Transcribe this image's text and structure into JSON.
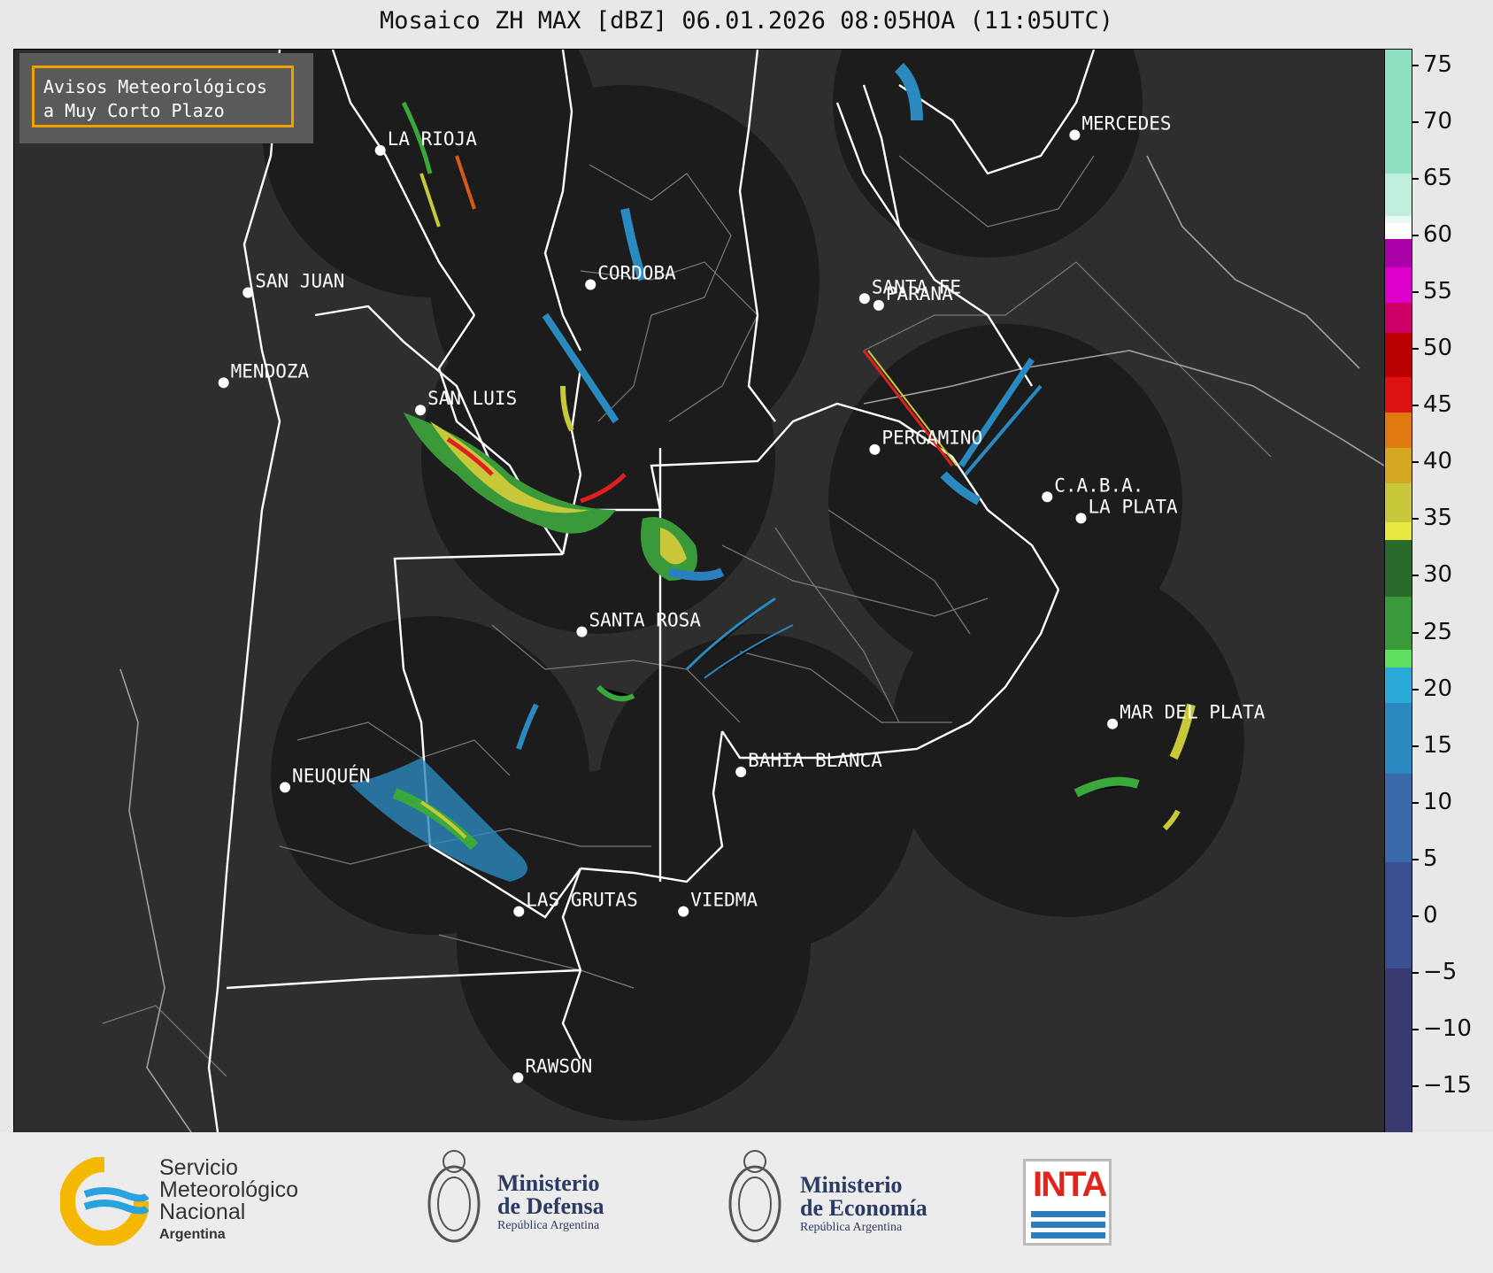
{
  "title": "Mosaico ZH MAX [dBZ] 06.01.2026 08:05HOA (11:05UTC)",
  "notice": {
    "line1": "Avisos Meteorológicos",
    "line2": "a Muy Corto Plazo"
  },
  "colors": {
    "notice_border": "#f0a000",
    "radar_coverage": "#1c1c1c",
    "map_background": "#2e2e2e",
    "province_border": "#ffffff"
  },
  "cities": [
    {
      "name": "LA RIOJA",
      "lon": -66.85,
      "lat": -29.41
    },
    {
      "name": "SAN JUAN",
      "lon": -68.53,
      "lat": -31.54
    },
    {
      "name": "CORDOBA",
      "lon": -64.18,
      "lat": -31.42
    },
    {
      "name": "SANTA FE",
      "lon": -60.7,
      "lat": -31.63
    },
    {
      "name": "PARANA",
      "lon": -60.52,
      "lat": -31.73
    },
    {
      "name": "MERCEDES",
      "lon": -58.03,
      "lat": -29.18
    },
    {
      "name": "MENDOZA",
      "lon": -68.84,
      "lat": -32.89
    },
    {
      "name": "SAN LUIS",
      "lon": -66.34,
      "lat": -33.3
    },
    {
      "name": "PERGAMINO",
      "lon": -60.57,
      "lat": -33.89
    },
    {
      "name": "C.A.B.A.",
      "lon": -58.38,
      "lat": -34.6
    },
    {
      "name": "LA PLATA",
      "lon": -57.95,
      "lat": -34.92
    },
    {
      "name": "SANTA ROSA",
      "lon": -64.29,
      "lat": -36.62
    },
    {
      "name": "MAR DEL PLATA",
      "lon": -57.55,
      "lat": -38.0
    },
    {
      "name": "BAHIA BLANCA",
      "lon": -62.27,
      "lat": -38.72
    },
    {
      "name": "NEUQUÉN",
      "lon": -68.06,
      "lat": -38.95
    },
    {
      "name": "LAS GRUTAS",
      "lon": -65.09,
      "lat": -40.81
    },
    {
      "name": "VIEDMA",
      "lon": -63.0,
      "lat": -40.81
    },
    {
      "name": "RAWSON",
      "lon": -65.1,
      "lat": -43.3
    }
  ],
  "colorbar": {
    "ticks": [
      75,
      70,
      65,
      60,
      55,
      50,
      45,
      40,
      35,
      30,
      25,
      20,
      15,
      10,
      5,
      0,
      -5,
      -10,
      -15
    ],
    "tick_labels": [
      "75",
      "70",
      "65",
      "60",
      "55",
      "50",
      "45",
      "40",
      "35",
      "30",
      "25",
      "20",
      "15",
      "10",
      "5",
      "0",
      "−5",
      "−10",
      "−15"
    ],
    "range": [
      -19,
      76.5
    ]
  },
  "footer": {
    "smn": {
      "line1": "Servicio",
      "line2": "Meteorológico",
      "line3": "Nacional",
      "line4": "Argentina"
    },
    "defensa": {
      "line1": "Ministerio",
      "line2": "de Defensa",
      "line3": "República Argentina"
    },
    "economia": {
      "line1": "Ministerio",
      "line2": "de Economía",
      "line3": "República Argentina"
    },
    "inta": "INTA"
  }
}
